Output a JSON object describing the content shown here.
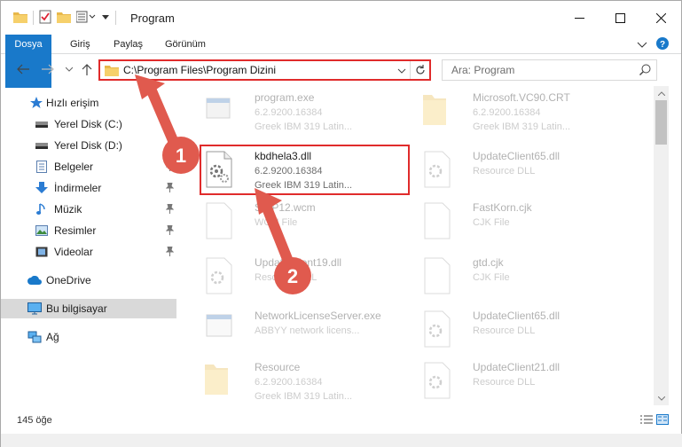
{
  "window": {
    "title": "Program"
  },
  "ribbon": {
    "tabs": [
      "Dosya",
      "Giriş",
      "Paylaş",
      "Görünüm"
    ]
  },
  "address": {
    "path": "C:\\Program Files\\Program Dizini"
  },
  "search": {
    "placeholder": "Ara: Program"
  },
  "nav": {
    "items": [
      {
        "label": "Hızlı erişim",
        "icon": "star-icon"
      },
      {
        "label": "Yerel Disk (C:)",
        "icon": "drive-icon"
      },
      {
        "label": "Yerel Disk (D:)",
        "icon": "drive-icon"
      },
      {
        "label": "Belgeler",
        "icon": "documents-icon"
      },
      {
        "label": "İndirmeler",
        "icon": "download-icon"
      },
      {
        "label": "Müzik",
        "icon": "music-icon"
      },
      {
        "label": "Resimler",
        "icon": "pictures-icon"
      },
      {
        "label": "Videolar",
        "icon": "videos-icon"
      },
      {
        "label": "OneDrive",
        "icon": "cloud-icon"
      },
      {
        "label": "Bu bilgisayar",
        "icon": "computer-icon"
      },
      {
        "label": "Ağ",
        "icon": "network-icon"
      }
    ]
  },
  "files": [
    {
      "name": "program.exe",
      "line1": "6.2.9200.16384",
      "line2": "Greek IBM 319 Latin..."
    },
    {
      "name": "Microsoft.VC90.CRT",
      "line1": "6.2.9200.16384",
      "line2": "Greek IBM 319 Latin..."
    },
    {
      "name": "kbdhela3.dll",
      "line1": "6.2.9200.16384",
      "line2": "Greek IBM 319 Latin..."
    },
    {
      "name": "UpdateClient65.dll",
      "line1": "Resource DLL",
      "line2": ""
    },
    {
      "name": "SWP12.wcm",
      "line1": "WCM File",
      "line2": ""
    },
    {
      "name": "FastKorn.cjk",
      "line1": "CJK File",
      "line2": ""
    },
    {
      "name": "UpdateClient19.dll",
      "line1": "Resource DLL",
      "line2": ""
    },
    {
      "name": "gtd.cjk",
      "line1": "CJK File",
      "line2": ""
    },
    {
      "name": "NetworkLicenseServer.exe",
      "line1": "ABBYY network licens...",
      "line2": ""
    },
    {
      "name": "UpdateClient65.dll",
      "line1": "Resource DLL",
      "line2": ""
    },
    {
      "name": "Resource",
      "line1": "6.2.9200.16384",
      "line2": "Greek IBM 319 Latin..."
    },
    {
      "name": "UpdateClient21.dll",
      "line1": "Resource DLL",
      "line2": ""
    }
  ],
  "status": {
    "count": "145 öğe"
  },
  "annotations": {
    "step1": "1",
    "step2": "2"
  },
  "colors": {
    "accent": "#1979ca",
    "highlight": "#e02b2b",
    "arrow": "#e05a4e"
  }
}
